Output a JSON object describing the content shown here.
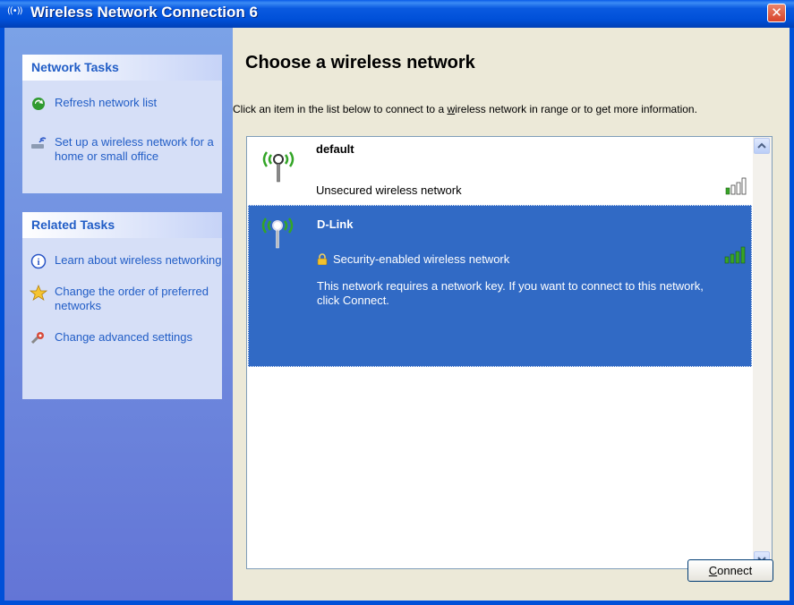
{
  "window": {
    "title": "Wireless Network Connection 6",
    "title_icon": "wireless-icon",
    "close_label": "✕"
  },
  "taskpane": {
    "network_tasks": {
      "header": "Network Tasks",
      "items": [
        {
          "label": "Refresh network list",
          "icon": "refresh-icon"
        },
        {
          "label": "Set up a wireless network for a home or small office",
          "icon": "wireless-setup-icon"
        }
      ]
    },
    "related_tasks": {
      "header": "Related Tasks",
      "items": [
        {
          "label": "Learn about wireless networking",
          "icon": "info-icon"
        },
        {
          "label": "Change the order of preferred networks",
          "icon": "star-icon"
        },
        {
          "label": "Change advanced settings",
          "icon": "advanced-settings-icon"
        }
      ]
    }
  },
  "main": {
    "heading": "Choose a wireless network",
    "instructions_before": "Click an item in the list below to connect to a ",
    "instructions_underlined": "w",
    "instructions_after": "ireless network in range or to get more information.",
    "networks": [
      {
        "name": "default",
        "status": "Unsecured wireless network",
        "secured": false,
        "signal_bars": 1,
        "selected": false
      },
      {
        "name": "D-Link",
        "status": "Security-enabled wireless network",
        "secured": true,
        "signal_bars": 4,
        "selected": true,
        "description": "This network requires a network key. If you want to connect to this network, click Connect."
      }
    ],
    "connect_button": {
      "underlined": "C",
      "rest": "onnect"
    }
  },
  "colors": {
    "titlebar": "#0050d8",
    "selection": "#316ac5",
    "task_link": "#215dc6",
    "signal_green": "#37a427"
  }
}
